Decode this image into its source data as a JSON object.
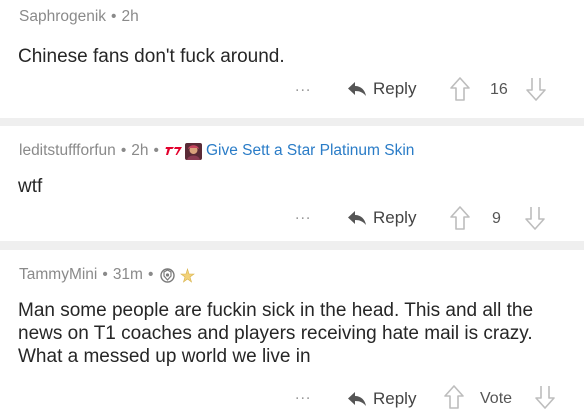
{
  "comments": [
    {
      "author": "Saphrogenik",
      "age": "2h",
      "flair_text": "",
      "body": "Chinese fans don't fuck around.",
      "more": "...",
      "reply_label": "Reply",
      "score": "16"
    },
    {
      "author": "leditstuffforfun",
      "age": "2h",
      "flair_text": "Give Sett a Star Platinum Skin",
      "body": "wtf",
      "more": "...",
      "reply_label": "Reply",
      "score": "9"
    },
    {
      "author": "TammyMini",
      "age": "31m",
      "flair_text": "",
      "body": "Man some people are fuckin sick in the head. This and all the news on T1 coaches and players receiving hate mail is crazy. What a messed up world we live in",
      "more": "...",
      "reply_label": "Reply",
      "score": "Vote"
    }
  ],
  "separator": "•",
  "colors": {
    "flair": "#2a7cc7",
    "meta": "#8a8a8a",
    "divider": "#efefef",
    "t1_red": "#e2012d"
  },
  "icons": [
    "reply-arrow-icon",
    "upvote-arrow-icon",
    "downvote-arrow-icon",
    "t1-logo-icon",
    "gen-g-logo-icon",
    "star-icon"
  ]
}
